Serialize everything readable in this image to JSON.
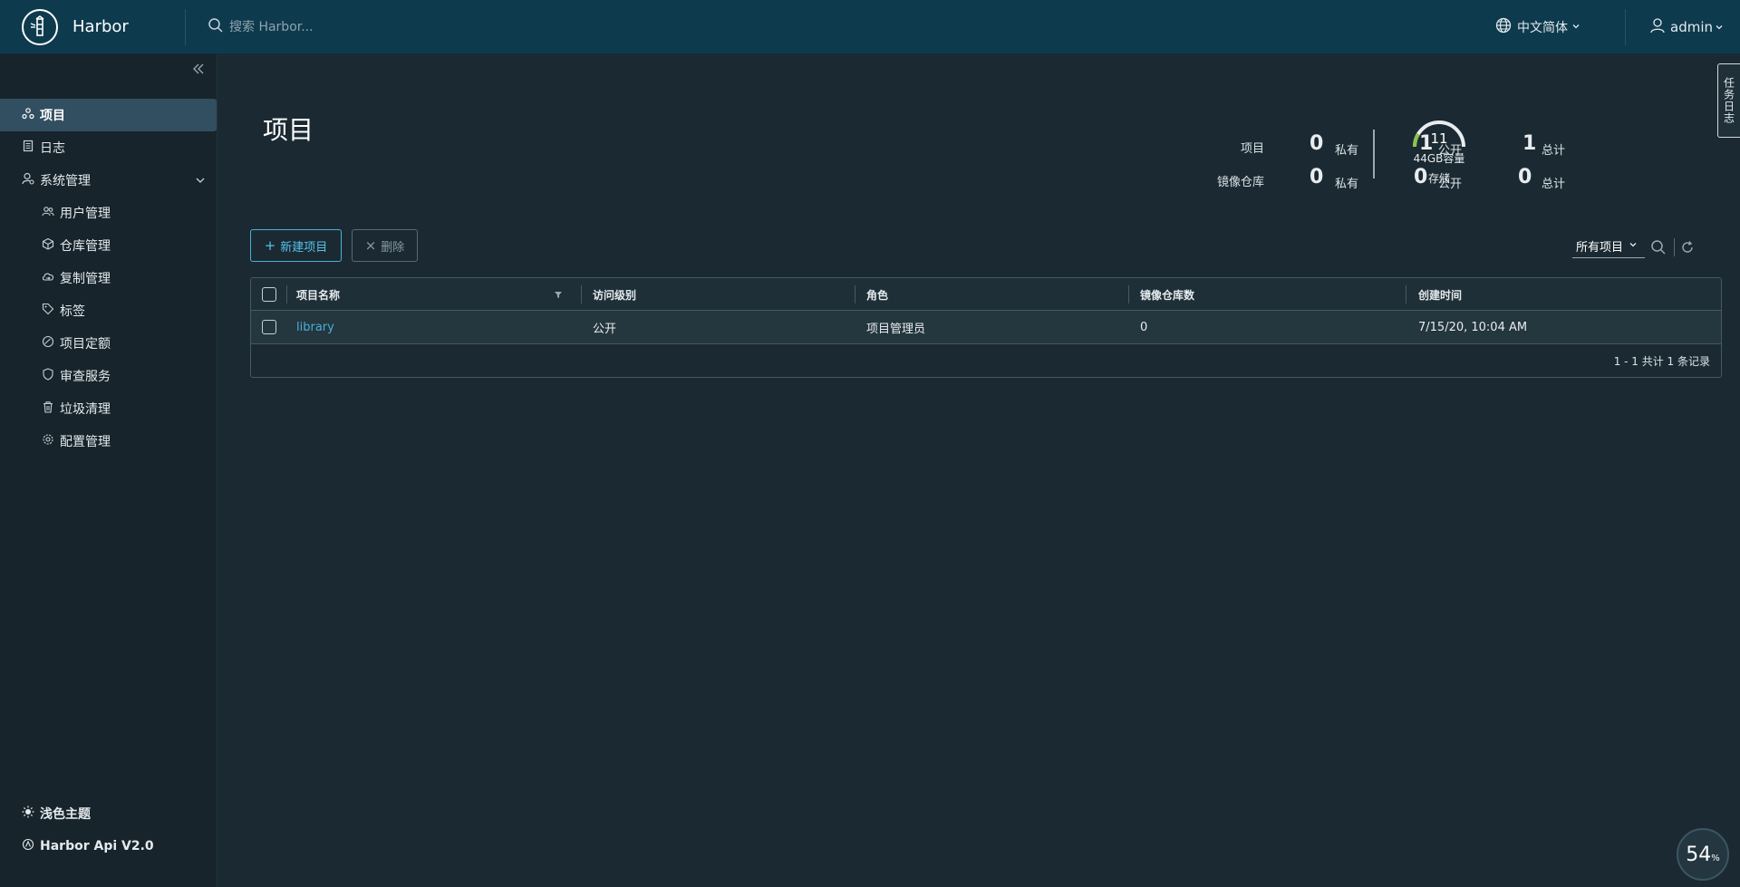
{
  "header": {
    "brand": "Harbor",
    "search_placeholder": "搜索 Harbor...",
    "language": "中文简体",
    "user": "admin"
  },
  "sidebar": {
    "items": [
      {
        "label": "项目",
        "icon": "projects-icon",
        "active": true
      },
      {
        "label": "日志",
        "icon": "logs-icon"
      },
      {
        "label": "系统管理",
        "icon": "admin-icon"
      }
    ],
    "sub_items": [
      {
        "label": "用户管理",
        "icon": "users-icon"
      },
      {
        "label": "仓库管理",
        "icon": "registry-icon"
      },
      {
        "label": "复制管理",
        "icon": "replication-icon"
      },
      {
        "label": "标签",
        "icon": "tag-icon"
      },
      {
        "label": "项目定额",
        "icon": "quota-icon"
      },
      {
        "label": "审查服务",
        "icon": "shield-icon"
      },
      {
        "label": "垃圾清理",
        "icon": "trash-icon"
      },
      {
        "label": "配置管理",
        "icon": "gear-icon"
      }
    ],
    "bottom": [
      {
        "label": "浅色主题",
        "icon": "sun-icon"
      },
      {
        "label": "Harbor Api V2.0",
        "icon": "api-icon"
      }
    ]
  },
  "main": {
    "title": "项目",
    "summary": {
      "projects_label": "项目",
      "repos_label": "镜像仓库",
      "private_label": "私有",
      "public_label": "公开",
      "total_label": "总计",
      "projects_private": "0",
      "projects_public": "1",
      "projects_total": "1",
      "repos_private": "0",
      "repos_public": "0",
      "repos_total": "0"
    },
    "storage": {
      "value": "11",
      "capacity": "44GB容量",
      "label": "存储"
    },
    "buttons": {
      "new_project": "新建项目",
      "delete": "删除"
    },
    "filter": {
      "selected": "所有项目"
    },
    "table": {
      "columns": [
        "项目名称",
        "访问级别",
        "角色",
        "镜像仓库数",
        "创建时间"
      ],
      "rows": [
        {
          "name": "library",
          "access": "公开",
          "role": "项目管理员",
          "repo_count": "0",
          "created": "7/15/20, 10:04 AM"
        }
      ],
      "footer": "1 - 1 共计 1 条记录"
    }
  },
  "side_tab": "任务日志",
  "perf_badge": {
    "value": "54",
    "unit": "%"
  },
  "colors": {
    "header_bg": "#0e3a4e",
    "sidebar_bg": "#17242b",
    "content_bg": "#1b2a32",
    "accent": "#49afd9",
    "active_nav": "#324f61"
  }
}
